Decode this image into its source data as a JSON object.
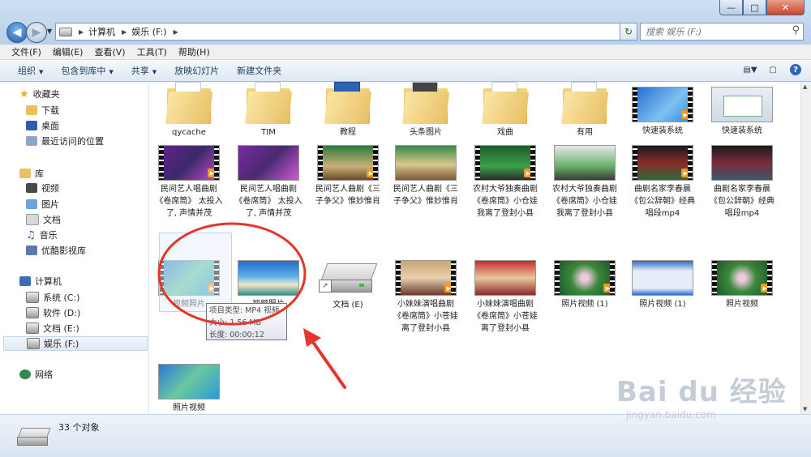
{
  "nav": {
    "back": "back",
    "forward": "forward",
    "path": [
      "计算机",
      "娱乐 (F:)"
    ],
    "search_placeholder": "搜索 娱乐 (F:)"
  },
  "window_controls": {
    "minimize": "—",
    "maximize": "□",
    "close": "✕"
  },
  "menu": [
    "文件(F)",
    "编辑(E)",
    "查看(V)",
    "工具(T)",
    "帮助(H)"
  ],
  "toolbar": [
    {
      "label": "组织",
      "dropdown": true
    },
    {
      "label": "包含到库中",
      "dropdown": true
    },
    {
      "label": "共享",
      "dropdown": true
    },
    {
      "label": "放映幻灯片",
      "dropdown": false
    },
    {
      "label": "新建文件夹",
      "dropdown": false
    }
  ],
  "sidebar": {
    "favorites": {
      "label": "收藏夹",
      "items": [
        "下载",
        "桌面",
        "最近访问的位置"
      ]
    },
    "libraries": {
      "label": "库",
      "items": [
        "视频",
        "图片",
        "文档",
        "音乐",
        "优酷影视库"
      ]
    },
    "computer": {
      "label": "计算机",
      "items": [
        "系统 (C:)",
        "软件 (D:)",
        "文档 (E:)",
        "娱乐 (F:)"
      ]
    },
    "network": {
      "label": "网络"
    }
  },
  "files": [
    {
      "name": "qycache",
      "type": "folder"
    },
    {
      "name": "TIM",
      "type": "folder"
    },
    {
      "name": "教程",
      "type": "folder"
    },
    {
      "name": "头条图片",
      "type": "folder"
    },
    {
      "name": "戏曲",
      "type": "folder"
    },
    {
      "name": "有用",
      "type": "folder"
    },
    {
      "name": "快速装系统",
      "type": "video"
    },
    {
      "name": "快速装系统",
      "type": "video"
    },
    {
      "name": "民间艺人唱曲剧《卷席筒》 太投入了, 声情并茂",
      "type": "video"
    },
    {
      "name": "民间艺人唱曲剧《卷席筒》 太投入了, 声情并茂",
      "type": "video"
    },
    {
      "name": "民间艺人曲剧《三子争父》惟妙惟肖",
      "type": "video"
    },
    {
      "name": "民间艺人曲剧《三子争父》惟妙惟肖",
      "type": "video"
    },
    {
      "name": "农村大爷独奏曲剧《卷席筒》小仓娃我离了登封小县",
      "type": "video"
    },
    {
      "name": "农村大爷独奏曲剧《卷席筒》小仓娃我离了登封小县",
      "type": "video"
    },
    {
      "name": "曲剧名家李春晨《包公辞朝》经典唱段mp4",
      "type": "video"
    },
    {
      "name": "曲剧名家李春晨《包公辞朝》经典唱段mp4",
      "type": "video"
    },
    {
      "name": "视频照片",
      "type": "video"
    },
    {
      "name": "视频照片",
      "type": "image"
    },
    {
      "name": "文档 (E)",
      "type": "drive-shortcut"
    },
    {
      "name": "小妹妹演唱曲剧《卷席筒》小苍娃离了登封小县",
      "type": "video"
    },
    {
      "name": "小妹妹演唱曲剧《卷席筒》小苍娃离了登封小县",
      "type": "video"
    },
    {
      "name": "照片视频 (1)",
      "type": "video"
    },
    {
      "name": "照片视频 (1)",
      "type": "video"
    },
    {
      "name": "照片视频",
      "type": "video"
    },
    {
      "name": "照片视频",
      "type": "video"
    }
  ],
  "tooltip": {
    "line1": "项目类型: MP4 视频",
    "line2": "大小: 1.56 MB",
    "line3": "长度: 00:00:12"
  },
  "status": {
    "count": "33 个对象"
  },
  "watermark": {
    "line1": "Bai du 经验",
    "line2": "jingyan.baidu.com"
  },
  "colors": {
    "selection": "#cfe2fb",
    "annotation": "#e8352a",
    "play_badge": "#f39a1e"
  }
}
